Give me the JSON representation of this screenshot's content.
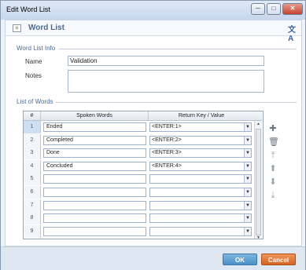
{
  "window": {
    "title": "Edit Word List",
    "min_glyph": "─",
    "max_glyph": "□",
    "close_glyph": "✕"
  },
  "header": {
    "title": "Word List",
    "app_icon": "⊞",
    "translate_icon": "文A"
  },
  "word_list_info": {
    "section_label": "Word List Info",
    "name_label": "Name",
    "name_value": "Validation",
    "notes_label": "Notes",
    "notes_value": ""
  },
  "list_of_words": {
    "section_label": "List of Words",
    "columns": [
      "#",
      "Spoken Words",
      "Return Key / Value"
    ],
    "dropdown_glyph": "▼",
    "scroll_up_glyph": "▲",
    "scroll_down_glyph": "▼",
    "rows": [
      {
        "num": "1",
        "word": "Ended",
        "key": "<ENTER:1>"
      },
      {
        "num": "2",
        "word": "Completed",
        "key": "<ENTER:2>"
      },
      {
        "num": "3",
        "word": "Done",
        "key": "<ENTER:3>"
      },
      {
        "num": "4",
        "word": "Concluded",
        "key": "<ENTER:4>"
      },
      {
        "num": "5",
        "word": "",
        "key": ""
      },
      {
        "num": "6",
        "word": "",
        "key": ""
      },
      {
        "num": "7",
        "word": "",
        "key": ""
      },
      {
        "num": "8",
        "word": "",
        "key": ""
      },
      {
        "num": "9",
        "word": "",
        "key": ""
      }
    ],
    "side_icons": [
      {
        "name": "add-icon",
        "glyph": "✚"
      },
      {
        "name": "trash-icon",
        "glyph": "🗑"
      },
      {
        "name": "move-top-icon",
        "glyph": "⤒"
      },
      {
        "name": "move-up-icon",
        "glyph": "⬆"
      },
      {
        "name": "move-down-icon",
        "glyph": "⬇"
      },
      {
        "name": "move-bottom-icon",
        "glyph": "⤓"
      }
    ]
  },
  "footer": {
    "ok_label": "OK",
    "cancel_label": "Cancel"
  }
}
